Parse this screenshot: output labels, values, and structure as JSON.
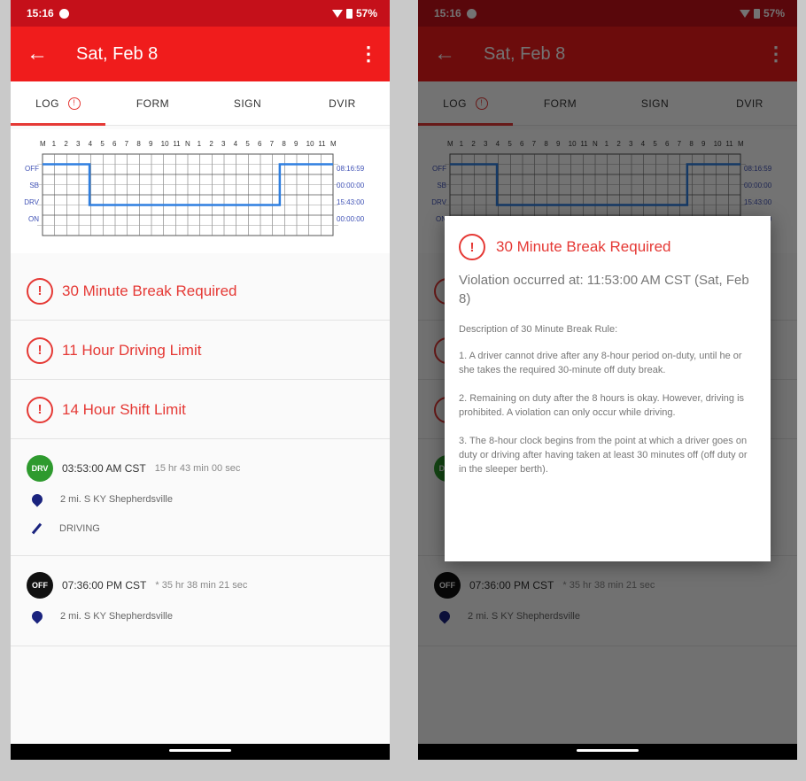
{
  "status": {
    "time": "15:16",
    "battery": "57%"
  },
  "appbar": {
    "back_icon": "arrow-back-icon",
    "title": "Sat, Feb 8",
    "more_icon": "more-vert-icon"
  },
  "tabs": [
    "LOG",
    "FORM",
    "SIGN",
    "DVIR"
  ],
  "graph": {
    "hours": [
      "M",
      "1",
      "2",
      "3",
      "4",
      "5",
      "6",
      "7",
      "8",
      "9",
      "10",
      "11",
      "N",
      "1",
      "2",
      "3",
      "4",
      "5",
      "6",
      "7",
      "8",
      "9",
      "10",
      "11",
      "M"
    ],
    "rows": [
      "OFF",
      "SB",
      "DRV",
      "ON"
    ],
    "totals": [
      "08:16:59",
      "00:00:00",
      "15:43:00",
      "00:00:00"
    ],
    "line_color": "#2f7fe0"
  },
  "violations": [
    {
      "title": "30 Minute Break Required"
    },
    {
      "title": "11 Hour Driving Limit"
    },
    {
      "title": "14 Hour Shift Limit"
    }
  ],
  "events": [
    {
      "status": "DRV",
      "status_color": "#2e9a2e",
      "time": "03:53:00 AM CST",
      "duration": "15 hr  43 min  00 sec",
      "location": "2 mi. S KY Shepherdsville",
      "note": "DRIVING"
    },
    {
      "status": "OFF",
      "status_color": "#111111",
      "time": "07:36:00 PM CST",
      "duration": "* 35 hr  38 min  21 sec",
      "location": "2 mi. S KY Shepherdsville"
    }
  ],
  "dialog": {
    "title": "30 Minute Break Required",
    "occurred": "Violation occurred at: 11:53:00 AM CST (Sat, Feb 8)",
    "description_title": "Description of 30 Minute Break Rule:",
    "rules": [
      "1. A driver cannot drive after any 8-hour period on-duty, until he or she takes the required 30-minute off duty break.",
      "2. Remaining on duty after the 8 hours is okay. However, driving is prohibited. A violation can only occur while driving.",
      "3. The 8-hour clock begins from the point at which a driver goes on duty or driving after having taken at least 30 minutes off (off duty or in the sleeper berth)."
    ]
  },
  "colors": {
    "brand_red": "#f01c1c",
    "status_red": "#c5101a",
    "violation_red": "#e53935"
  }
}
